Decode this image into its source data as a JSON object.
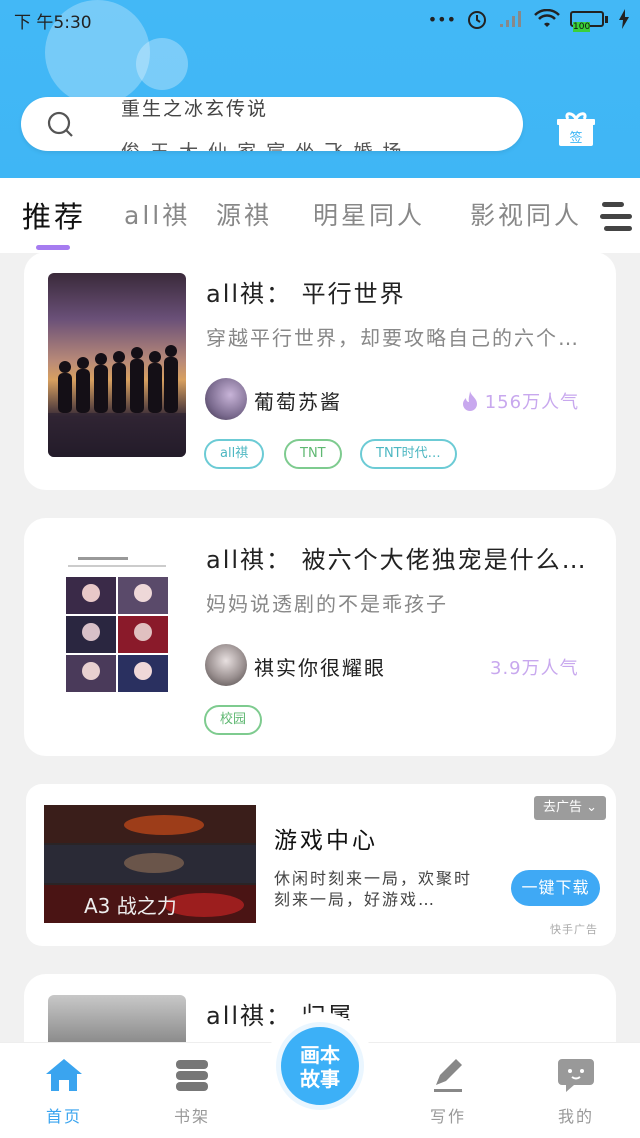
{
  "status_bar": {
    "time": "下 午5:30",
    "battery": "100"
  },
  "search": {
    "text_line1": "重生之冰玄传说",
    "text_line2": "俊 王 大 仙 家 宸 坐 飞 婚 场"
  },
  "gift_label": "签",
  "tabs": [
    {
      "label": "推荐",
      "active": true
    },
    {
      "label": "all祺"
    },
    {
      "label": "源祺"
    },
    {
      "label": "明星同人"
    },
    {
      "label": "影视同人"
    }
  ],
  "stories": [
    {
      "title": "all祺： 平行世界",
      "desc": "穿越平行世界，却要攻略自己的六个…",
      "author": "葡萄苏酱",
      "popularity": "156万人气",
      "tags": [
        "all祺",
        "TNT",
        "TNT时代…"
      ]
    },
    {
      "title": "all祺： 被六个大佬独宠是什么…",
      "desc": "妈妈说透剧的不是乖孩子",
      "author": "祺实你很耀眼",
      "popularity": "3.9万人气",
      "tags": [
        "校园"
      ]
    },
    {
      "title": "all祺： 归属"
    }
  ],
  "ad": {
    "title": "游戏中心",
    "desc": "休闲时刻来一局，欢聚时刻来一局，好游戏…",
    "close_label": "去广告",
    "button_label": "一键下载",
    "source": "快手广告",
    "image_text": "A3 战之力"
  },
  "bottom_nav": [
    {
      "label": "首页",
      "icon": "home-icon",
      "active": true
    },
    {
      "label": "书架",
      "icon": "bookshelf-icon"
    },
    {
      "label": "写作",
      "icon": "pen-icon"
    },
    {
      "label": "我的",
      "icon": "chat-bubble-icon"
    }
  ],
  "center_button": {
    "line1": "画本",
    "line2": "故事"
  },
  "colors": {
    "accent": "#3fb6f5",
    "tab_indicator": "#a67cf0",
    "popularity": "#c8a8ee",
    "tag_teal": "#6ccbd5",
    "tag_green": "#7ecb8f"
  }
}
